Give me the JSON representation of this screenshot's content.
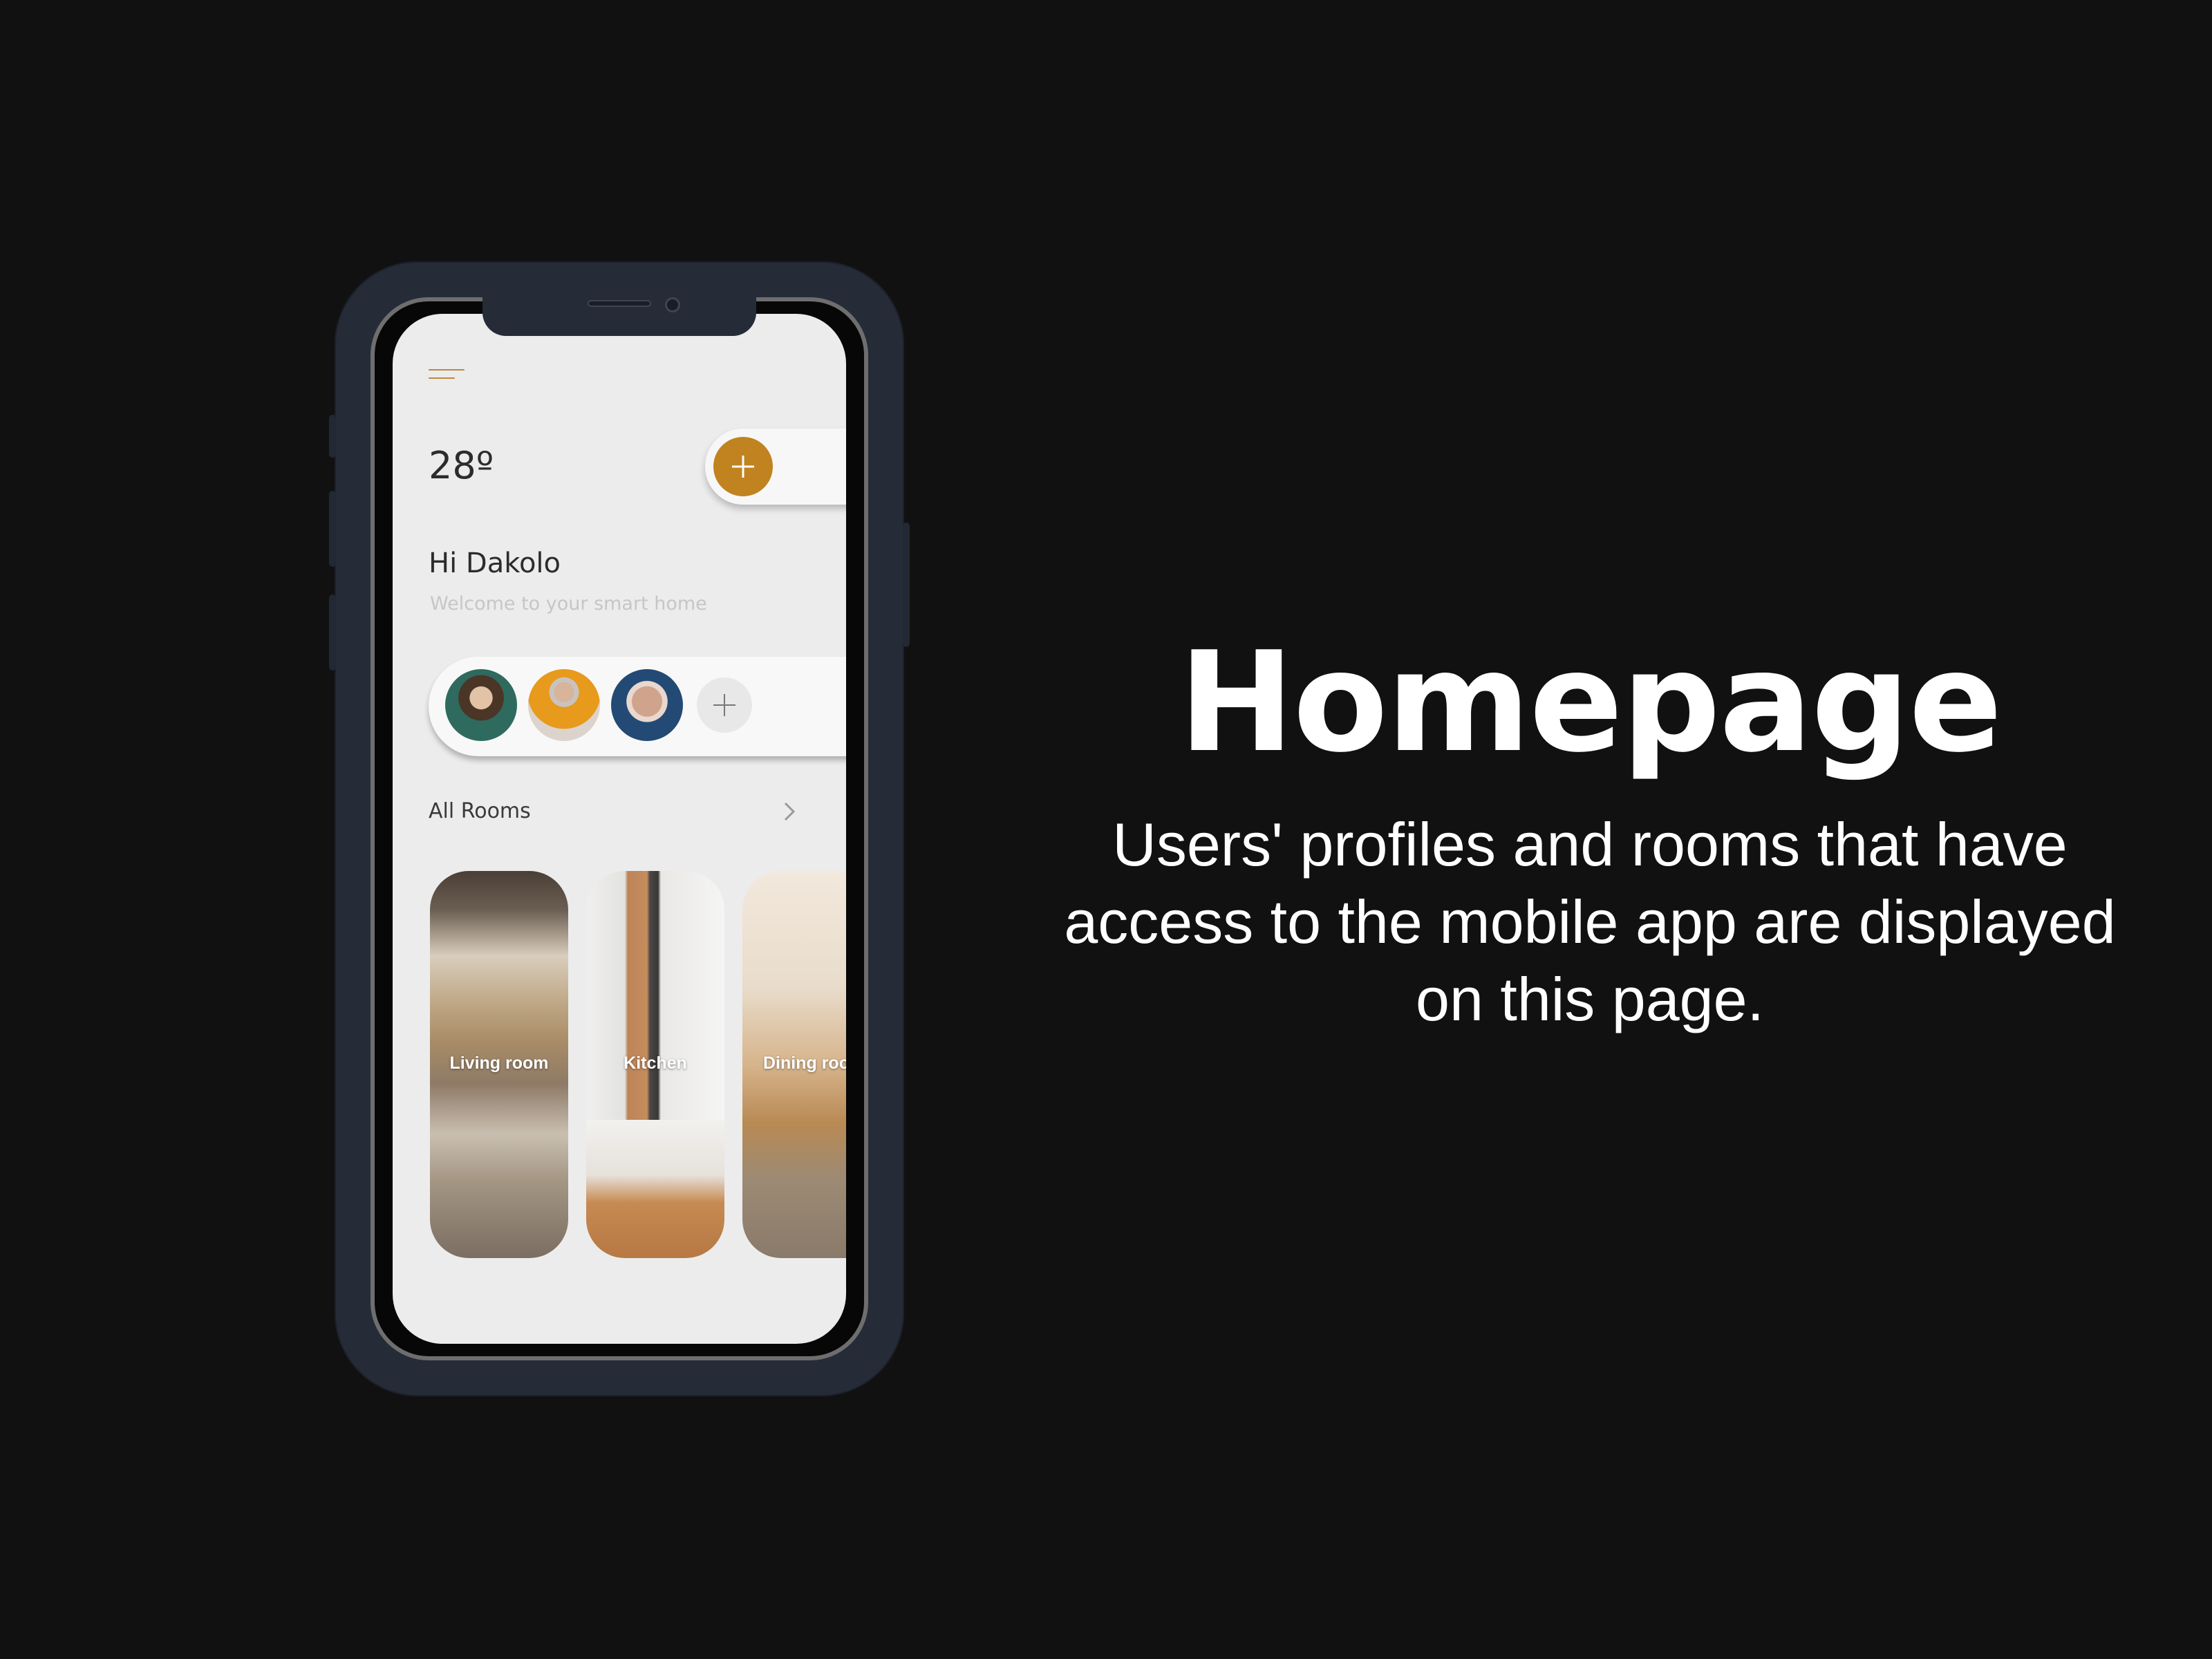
{
  "slide": {
    "headline": "Homepage",
    "description": "Users' profiles and rooms that have access to the mobile app are displayed on this page."
  },
  "app": {
    "accent_color": "#c0831f",
    "menu_icon": "hamburger-menu-icon",
    "temperature": "28º",
    "add_icon": "plus-icon",
    "greeting": "Hi Dakolo",
    "welcome": "Welcome to your smart home",
    "profiles": [
      {
        "name": "user-profile-1"
      },
      {
        "name": "user-profile-2"
      },
      {
        "name": "user-profile-3"
      }
    ],
    "add_profile_icon": "plus-icon",
    "rooms_heading": "All Rooms",
    "rooms_chevron_icon": "chevron-right-icon",
    "rooms": [
      {
        "label": "Living room"
      },
      {
        "label": "Kitchen"
      },
      {
        "label": "Dining room"
      }
    ]
  }
}
